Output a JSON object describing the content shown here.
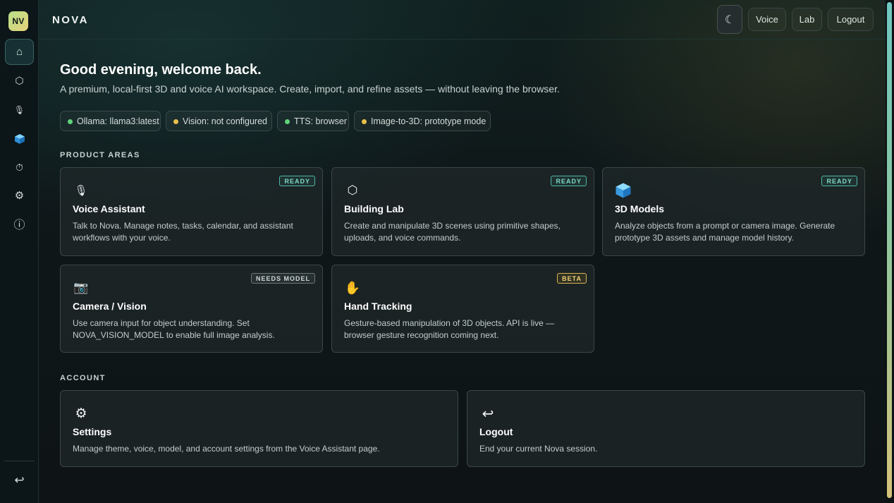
{
  "app": {
    "logo": "NV",
    "brand": "NOVA"
  },
  "sidebar": {
    "items": [
      {
        "icon": "home-icon",
        "glyph": "⌂",
        "active": true
      },
      {
        "icon": "hexagon-icon",
        "glyph": "⬡"
      },
      {
        "icon": "microphone-icon",
        "glyph": "🎙"
      },
      {
        "icon": "cube-icon",
        "glyph": ""
      },
      {
        "icon": "timer-icon",
        "glyph": "⏱"
      },
      {
        "icon": "gear-icon",
        "glyph": "⚙"
      },
      {
        "icon": "info-icon",
        "glyph": "ⓘ"
      }
    ],
    "logout_glyph": "↩"
  },
  "topbar": {
    "theme_glyph": "☾",
    "voice_label": "Voice",
    "lab_label": "Lab",
    "logout_label": "Logout"
  },
  "hero": {
    "greeting": "Good evening, welcome back.",
    "subtitle": "A premium, local-first 3D and voice AI workspace. Create, import, and refine assets — without leaving the browser."
  },
  "status_chips": [
    {
      "label": "Ollama: llama3:latest",
      "color": "#5fd37a"
    },
    {
      "label": "Vision: not configured",
      "color": "#e8c04a"
    },
    {
      "label": "TTS: browser",
      "color": "#5fd37a"
    },
    {
      "label": "Image-to-3D: prototype mode",
      "color": "#e8c04a"
    }
  ],
  "product_areas": {
    "heading": "PRODUCT AREAS",
    "cards": [
      {
        "title": "Voice Assistant",
        "desc": "Talk to Nova. Manage notes, tasks, calendar, and assistant workflows with your voice.",
        "badge": "READY",
        "icon": "microphone-icon",
        "glyph": "🎙"
      },
      {
        "title": "Building Lab",
        "desc": "Create and manipulate 3D scenes using primitive shapes, uploads, and voice commands.",
        "badge": "READY",
        "icon": "hexagon-icon",
        "glyph": "⬡"
      },
      {
        "title": "3D Models",
        "desc": "Analyze objects from a prompt or camera image. Generate prototype 3D assets and manage model history.",
        "badge": "READY",
        "icon": "cube-icon",
        "glyph": ""
      },
      {
        "title": "Camera / Vision",
        "desc": "Use camera input for object understanding. Set NOVA_VISION_MODEL to enable full image analysis.",
        "badge": "NEEDS MODEL",
        "icon": "camera-icon",
        "glyph": "📷"
      },
      {
        "title": "Hand Tracking",
        "desc": "Gesture-based manipulation of 3D objects. API is live — browser gesture recognition coming next.",
        "badge": "BETA",
        "icon": "hand-icon",
        "glyph": "✋"
      }
    ]
  },
  "account": {
    "heading": "ACCOUNT",
    "cards": [
      {
        "title": "Settings",
        "desc": "Manage theme, voice, model, and account settings from the Voice Assistant page.",
        "icon": "gear-icon",
        "glyph": "⚙"
      },
      {
        "title": "Logout",
        "desc": "End your current Nova session.",
        "icon": "logout-icon",
        "glyph": "↩"
      }
    ]
  }
}
